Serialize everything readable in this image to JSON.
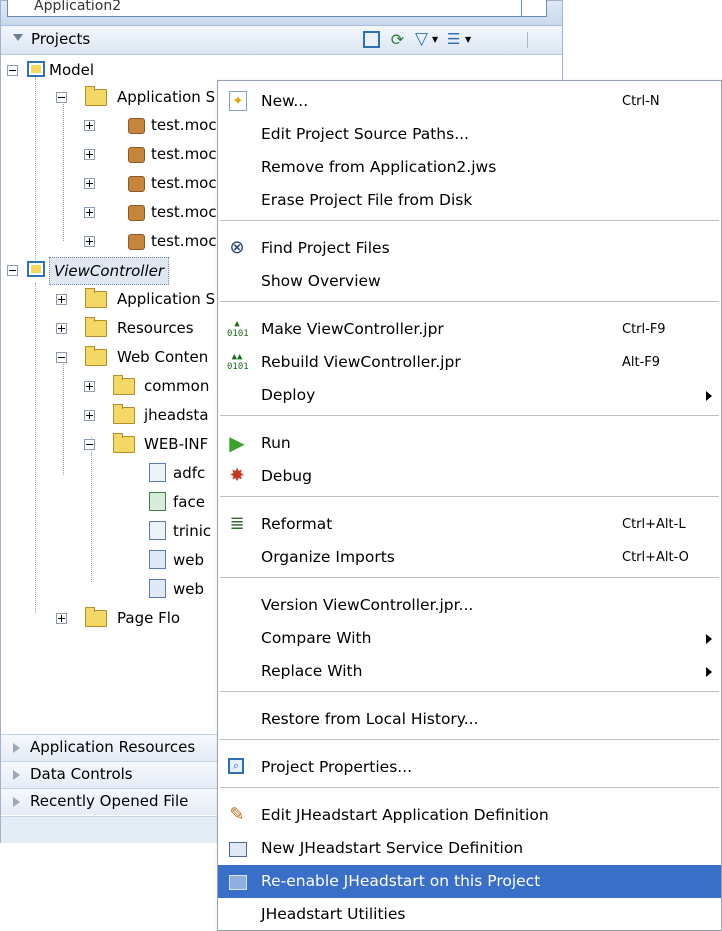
{
  "app_window": {
    "title": "Application2"
  },
  "projects_header": {
    "title": "Projects"
  },
  "tree": {
    "model": "Model",
    "model_app_sources": "Application S",
    "model_children": [
      "test.moc",
      "test.moc",
      "test.moc",
      "test.moc",
      "test.moc"
    ],
    "view_controller": "ViewController",
    "vc_app_sources": "Application S",
    "vc_resources": "Resources",
    "vc_web_content": "Web Conten",
    "web_children": [
      "common",
      "jheadsta",
      "WEB-INF"
    ],
    "webinf_children": [
      "adfc",
      "face",
      "trinic",
      "web",
      "web"
    ],
    "page_flows": "Page Flo"
  },
  "accordion": [
    "Application Resources",
    "Data Controls",
    "Recently Opened File"
  ],
  "context_menu": {
    "new": {
      "label": "New...",
      "shortcut": "Ctrl-N"
    },
    "edit_source_paths": "Edit Project Source Paths...",
    "remove_from_app": "Remove from Application2.jws",
    "erase_project_file": "Erase Project File from Disk",
    "find_project_files": "Find Project Files",
    "show_overview": "Show Overview",
    "make": {
      "label": "Make ViewController.jpr",
      "shortcut": "Ctrl-F9"
    },
    "rebuild": {
      "label": "Rebuild ViewController.jpr",
      "shortcut": "Alt-F9"
    },
    "deploy": "Deploy",
    "run": "Run",
    "debug": "Debug",
    "reformat": {
      "label": "Reformat",
      "shortcut": "Ctrl+Alt-L"
    },
    "organize_imports": {
      "label": "Organize Imports",
      "shortcut": "Ctrl+Alt-O"
    },
    "version": "Version ViewController.jpr...",
    "compare_with": "Compare With",
    "replace_with": "Replace With",
    "restore_history": "Restore from Local History...",
    "project_properties": "Project Properties...",
    "edit_jhs_app_def": "Edit JHeadstart Application Definition",
    "new_jhs_service_def": "New JHeadstart Service Definition",
    "reenable_jhs": "Re-enable JHeadstart on this Project",
    "jhs_utilities": "JHeadstart Utilities"
  },
  "colors": {
    "highlight": "#3a6fc9",
    "folder": "#f5d766"
  }
}
